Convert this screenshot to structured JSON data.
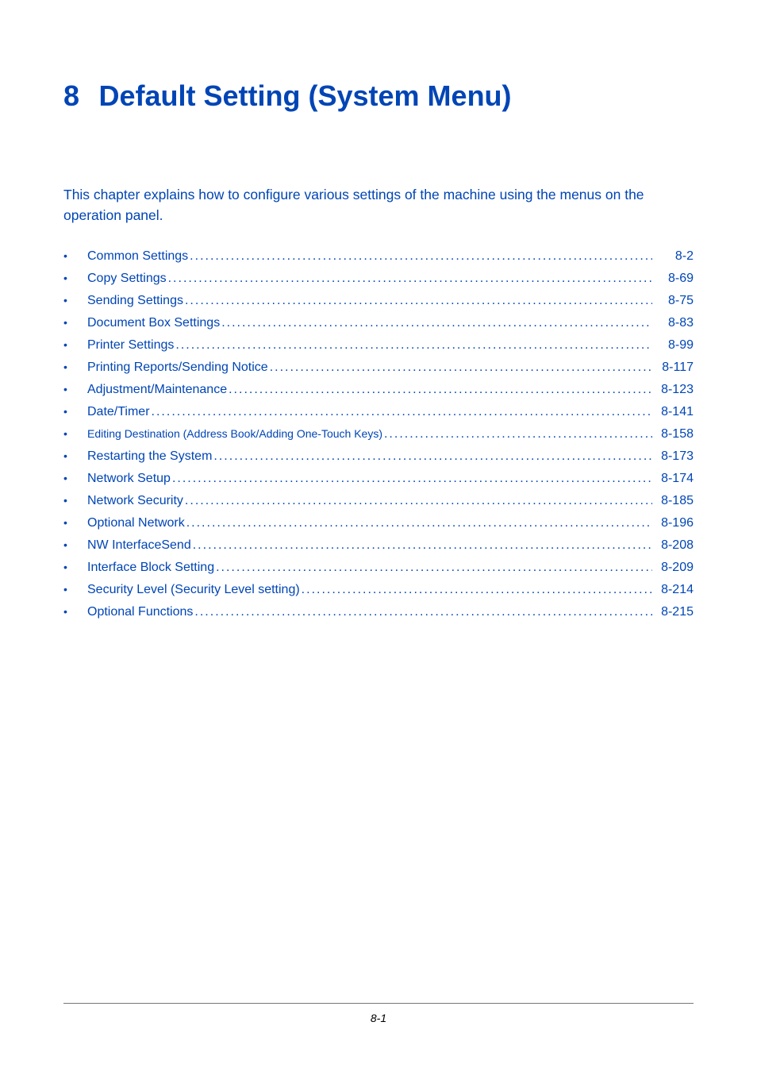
{
  "header": {
    "chapter_number": "8",
    "chapter_title": "Default Setting (System Menu)"
  },
  "intro": "This chapter explains how to configure various settings of the machine using the menus on the operation panel.",
  "toc": [
    {
      "label": "Common Settings",
      "page": "8-2",
      "small": false
    },
    {
      "label": "Copy Settings",
      "page": "8-69",
      "small": false
    },
    {
      "label": "Sending Settings",
      "page": "8-75",
      "small": false
    },
    {
      "label": "Document Box Settings",
      "page": "8-83",
      "small": false
    },
    {
      "label": "Printer Settings",
      "page": "8-99",
      "small": false
    },
    {
      "label": "Printing Reports/Sending Notice",
      "page": "8-117",
      "small": false
    },
    {
      "label": "Adjustment/Maintenance",
      "page": "8-123",
      "small": false
    },
    {
      "label": "Date/Timer",
      "page": "8-141",
      "small": false
    },
    {
      "label": "Editing Destination (Address Book/Adding One-Touch Keys)",
      "page": "8-158",
      "small": true
    },
    {
      "label": "Restarting the System",
      "page": "8-173",
      "small": false
    },
    {
      "label": "Network Setup",
      "page": "8-174",
      "small": false
    },
    {
      "label": "Network Security",
      "page": "8-185",
      "small": false
    },
    {
      "label": "Optional Network",
      "page": "8-196",
      "small": false
    },
    {
      "label": "NW InterfaceSend",
      "page": "8-208",
      "small": false
    },
    {
      "label": "Interface Block Setting",
      "page": "8-209",
      "small": false
    },
    {
      "label": "Security Level (Security Level setting)",
      "page": "8-214",
      "small": false
    },
    {
      "label": "Optional Functions",
      "page": "8-215",
      "small": false
    }
  ],
  "footer": {
    "page_number": "8-1"
  }
}
